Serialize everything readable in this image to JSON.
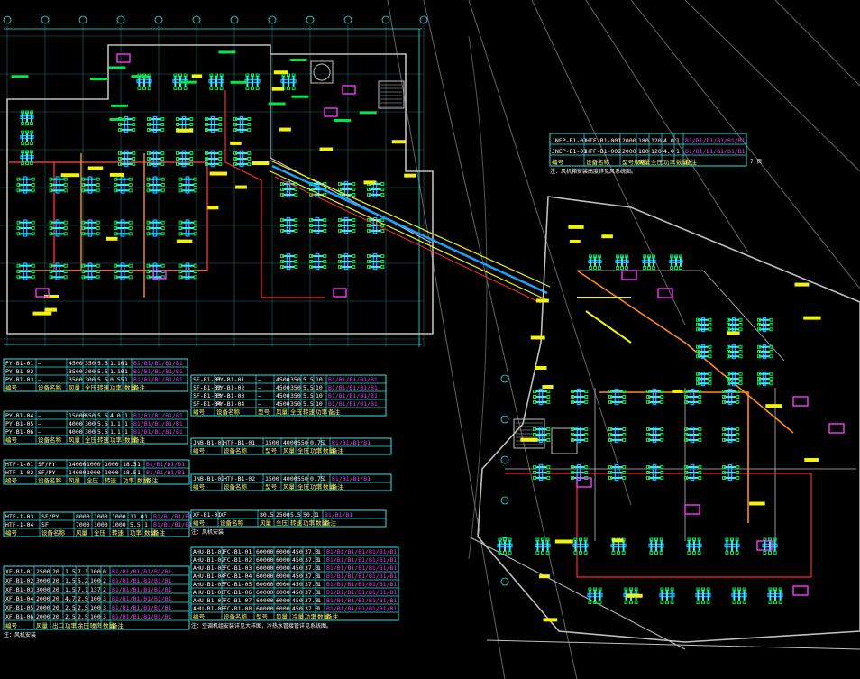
{
  "drawing": {
    "background": "#000000",
    "palette": {
      "grid": "#2ee8e8",
      "wall": "#bfbfbf",
      "duct_supply": "#1fa0ff",
      "duct_return": "#00e84a",
      "duct_branch": "#2ef2ff",
      "pipe_hot": "#ff2a2a",
      "pipe_orange": "#ff8c1a",
      "equipment": "#ff33ff",
      "label": "#f2f20a",
      "white": "#ffffff",
      "table_line": "#2ee8e8",
      "table_text": "#ffffff",
      "table_text_alt": "#ffff66",
      "table_highlight": "#e03cf0"
    }
  },
  "tables": {
    "right_top": {
      "rows": [
        [
          "JNEP-B1-01",
          "HTF-B1-001",
          "2000",
          "180",
          "120",
          "4.0",
          "1",
          "B1/B1/B1/B1/B1/B1"
        ],
        [
          "JNEP-B1-01",
          "HTF-B1-002",
          "2000",
          "180",
          "120",
          "4.0",
          "1",
          "B1/B1/B1/B1/B1/B1"
        ],
        [
          "编号",
          "设备名称",
          "型号规格",
          "风量",
          "全压",
          "功率",
          "数量",
          "备注"
        ]
      ],
      "footer": "注：风机箱安装高度详见风系统图。",
      "right_cell": "7 页"
    },
    "left_1": {
      "rows": [
        [
          "PY-B1-01",
          "—",
          "4500",
          "350",
          "5.5",
          "1.10",
          "1",
          "B1/B1/B1/B1/B1"
        ],
        [
          "PY-B1-02",
          "—",
          "3500",
          "300",
          "5.5",
          "1.10",
          "1",
          "B1/B1/B1/B1/B1"
        ],
        [
          "PY-B1-03",
          "—",
          "3500",
          "300",
          "5.5",
          "0.55",
          "1",
          "B1/B1/B1/B1/B1"
        ],
        [
          "编号",
          "设备名称",
          "风量",
          "全压",
          "转速",
          "功率",
          "数量",
          "备注"
        ]
      ]
    },
    "left_2": {
      "rows": [
        [
          "PY-B1-04",
          "—",
          "15000",
          "650",
          "5.5",
          "4.0",
          "1",
          "B1/B1/B1/B1/B1"
        ],
        [
          "PY-B1-05",
          "—",
          "4000",
          "300",
          "5.5",
          "1.1",
          "1",
          "B1/B1/B1/B1/B1"
        ],
        [
          "PY-B1-06",
          "—",
          "4000",
          "300",
          "5.5",
          "1.1",
          "1",
          "B1/B1/B1/B1/B1"
        ],
        [
          "编号",
          "设备名称",
          "风量",
          "全压",
          "转速",
          "功率",
          "数量",
          "备注"
        ]
      ]
    },
    "left_3": {
      "rows": [
        [
          "HTF-1-01",
          "SF/PY",
          "14000",
          "1000",
          "1000",
          "18.5",
          "1",
          "B1/B1/B1/B1"
        ],
        [
          "HTF-1-02",
          "SF/PY",
          "14000",
          "1000",
          "1000",
          "18.5",
          "1",
          "B1/B1/B1/B1"
        ],
        [
          "编号",
          "设备名称",
          "风量",
          "全压",
          "转速",
          "功率",
          "数量",
          "备注"
        ]
      ]
    },
    "left_4": {
      "rows": [
        [
          "HTF-1-03",
          "SF/PY",
          "8000",
          "1000",
          "1000",
          "11.0",
          "1",
          "B1/B1/B1/B1"
        ],
        [
          "HTF-1-04",
          "SF",
          "7000",
          "1000",
          "1000",
          "5.5",
          "1",
          "B1/B1/B1/B1"
        ],
        [
          "编号",
          "设备名称",
          "风量",
          "全压",
          "转速",
          "功率",
          "数量",
          "备注"
        ]
      ]
    },
    "left_5": {
      "rows": [
        [
          "XF-B1-01",
          "2500",
          "20",
          "1.5",
          "7.1",
          "100",
          "0",
          "B1/B1/B1/B1/B1/B1"
        ],
        [
          "XF-B1-02",
          "3000",
          "20",
          "1.5",
          "5.2",
          "100",
          "2",
          "B1/B1/B1/B1/B1/B1"
        ],
        [
          "XF-B1-03",
          "3000",
          "20",
          "1.5",
          "7.1",
          "137",
          "2",
          "B1/B1/B1/B1/B1/B1"
        ],
        [
          "XF-B1-04",
          "2000",
          "20",
          "4.7",
          "2.5",
          "100",
          "3",
          "B1/B1/B1/B1/B1/B1"
        ],
        [
          "XF-B1-05",
          "2000",
          "20",
          "2.5",
          "2.5",
          "100",
          "3",
          "B1/B1/B1/B1/B1/B1"
        ],
        [
          "XF-B1-06",
          "2000",
          "20",
          "2.5",
          "2.5",
          "100",
          "3",
          "B1/B1/B1/B1/B1/B1"
        ],
        [
          "编号",
          "风量",
          "出口",
          "功率",
          "余压",
          "噪声",
          "数量",
          "备注"
        ]
      ],
      "footer": "注：风机安装"
    },
    "mid_1": {
      "rows": [
        [
          "SF-B1-01",
          "PY-B1-01",
          "—",
          "4500",
          "350",
          "5.5",
          "10",
          "B1/B1/B1/B1/B1"
        ],
        [
          "SF-B1-02",
          "PY-B1-02",
          "—",
          "4500",
          "350",
          "5.5",
          "10",
          "B1/B1/B1/B1/B1"
        ],
        [
          "SF-B1-03",
          "PY-B1-03",
          "—",
          "4500",
          "350",
          "5.5",
          "10",
          "B1/B1/B1/B1/B1"
        ],
        [
          "SF-B1-04",
          "PY-B1-04",
          "—",
          "4500",
          "350",
          "5.5",
          "10",
          "B1/B1/B1/B1/B1"
        ],
        [
          "编号",
          "设备名称",
          "型号",
          "风量",
          "全压",
          "转速",
          "功率",
          "备注"
        ]
      ]
    },
    "mid_2": {
      "rows": [
        [
          "JNB-B1-01",
          "HTF-B1-01",
          "1500",
          "4000",
          "550",
          "0.75",
          "1",
          "B1/B1/B1/B1"
        ],
        [
          "编号",
          "设备名称",
          "型号",
          "风量",
          "全压",
          "功率",
          "数量",
          "备注"
        ]
      ]
    },
    "mid_3": {
      "rows": [
        [
          "JNB-B1-02",
          "HTF-B1-02",
          "1500",
          "4000",
          "550",
          "0.75",
          "1",
          "B1/B1/B1/B1"
        ],
        [
          "编号",
          "设备名称",
          "型号",
          "风量",
          "全压",
          "功率",
          "数量",
          "备注"
        ]
      ]
    },
    "mid_4": {
      "rows": [
        [
          "XF-B1-01",
          "XF",
          "80.5",
          "2500",
          "5.5",
          "50.1",
          "1",
          "B1/B1/B1"
        ],
        [
          "编号",
          "设备名称",
          "风量",
          "全压",
          "转速",
          "功率",
          "数量",
          "备注"
        ]
      ],
      "footer": "注：风机安装"
    },
    "mid_5": {
      "rows": [
        [
          "AHU-B1-01",
          "FC-B1-01",
          "60000",
          "6000",
          "450",
          "37.0",
          "1",
          "B1/B1/B1/B1/B1/B1/B1"
        ],
        [
          "AHU-B1-02",
          "FC-B1-02",
          "60000",
          "6000",
          "450",
          "37.0",
          "1",
          "B1/B1/B1/B1/B1/B1/B1"
        ],
        [
          "AHU-B1-03",
          "FC-B1-03",
          "60000",
          "6000",
          "450",
          "37.0",
          "1",
          "B1/B1/B1/B1/B1/B1/B1"
        ],
        [
          "AHU-B1-04",
          "FC-B1-04",
          "60000",
          "6000",
          "450",
          "37.0",
          "1",
          "B1/B1/B1/B1/B1/B1/B1"
        ],
        [
          "AHU-B1-05",
          "FC-B1-05",
          "60000",
          "6000",
          "450",
          "37.0",
          "1",
          "B1/B1/B1/B1/B1/B1/B1"
        ],
        [
          "AHU-B1-06",
          "FC-B1-06",
          "60000",
          "6000",
          "450",
          "37.0",
          "1",
          "B1/B1/B1/B1/B1/B1/B1"
        ],
        [
          "AHU-B1-07",
          "FC-B1-07",
          "60000",
          "6000",
          "450",
          "37.0",
          "1",
          "B1/B1/B1/B1/B1/B1/B1"
        ],
        [
          "AHU-B1-08",
          "FC-B1-08",
          "60000",
          "6000",
          "450",
          "37.0",
          "1",
          "B1/B1/B1/B1/B1/B1/B1"
        ],
        [
          "编号",
          "设备名称",
          "型号",
          "风量",
          "冷量",
          "功率",
          "数量",
          "备注"
        ]
      ],
      "footer": "注：空调机组安装详见大样图，冷热水管接管详见系统图。"
    }
  }
}
